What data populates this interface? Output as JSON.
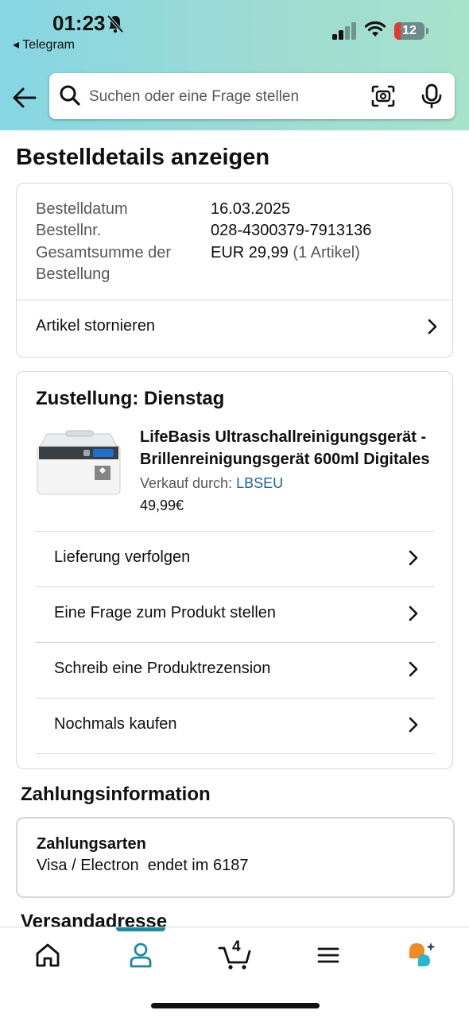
{
  "status_bar": {
    "time": "01:23",
    "back_app": "◂ Telegram",
    "battery_level": "12"
  },
  "search": {
    "placeholder": "Suchen oder eine Frage stellen"
  },
  "page_title": "Bestelldetails anzeigen",
  "order_summary": {
    "date_label": "Bestelldatum",
    "date_value": "16.03.2025",
    "number_label": "Bestellnr.",
    "number_value": "028-4300379-7913136",
    "total_label_line1": "Gesamtsumme der",
    "total_label_line2": "Bestellung",
    "total_value": "EUR 29,99",
    "total_items": "(1 Artikel)",
    "cancel_label": "Artikel stornieren"
  },
  "delivery": {
    "heading": "Zustellung: Dienstag",
    "product_title_line1": "LifeBasis Ultraschallreinigungsgerät -",
    "product_title_line2": "Brillenreinigungsgerät 600ml Digitales",
    "seller_prefix": "Verkauf durch:",
    "seller_name": "LBSEU",
    "price": "49,99€",
    "actions": [
      {
        "label": "Lieferung verfolgen"
      },
      {
        "label": "Eine Frage zum Produkt stellen"
      },
      {
        "label": "Schreib eine Produktrezension"
      },
      {
        "label": "Nochmals kaufen"
      }
    ]
  },
  "payment": {
    "heading": "Zahlungsinformation",
    "method_label": "Zahlungsarten",
    "method_value": "Visa / Electron  endet im 6187"
  },
  "shipping_heading": "Versandadresse",
  "bottom_nav": {
    "cart_count": "4",
    "active": "account",
    "accent_color": "#1f8a9c"
  }
}
